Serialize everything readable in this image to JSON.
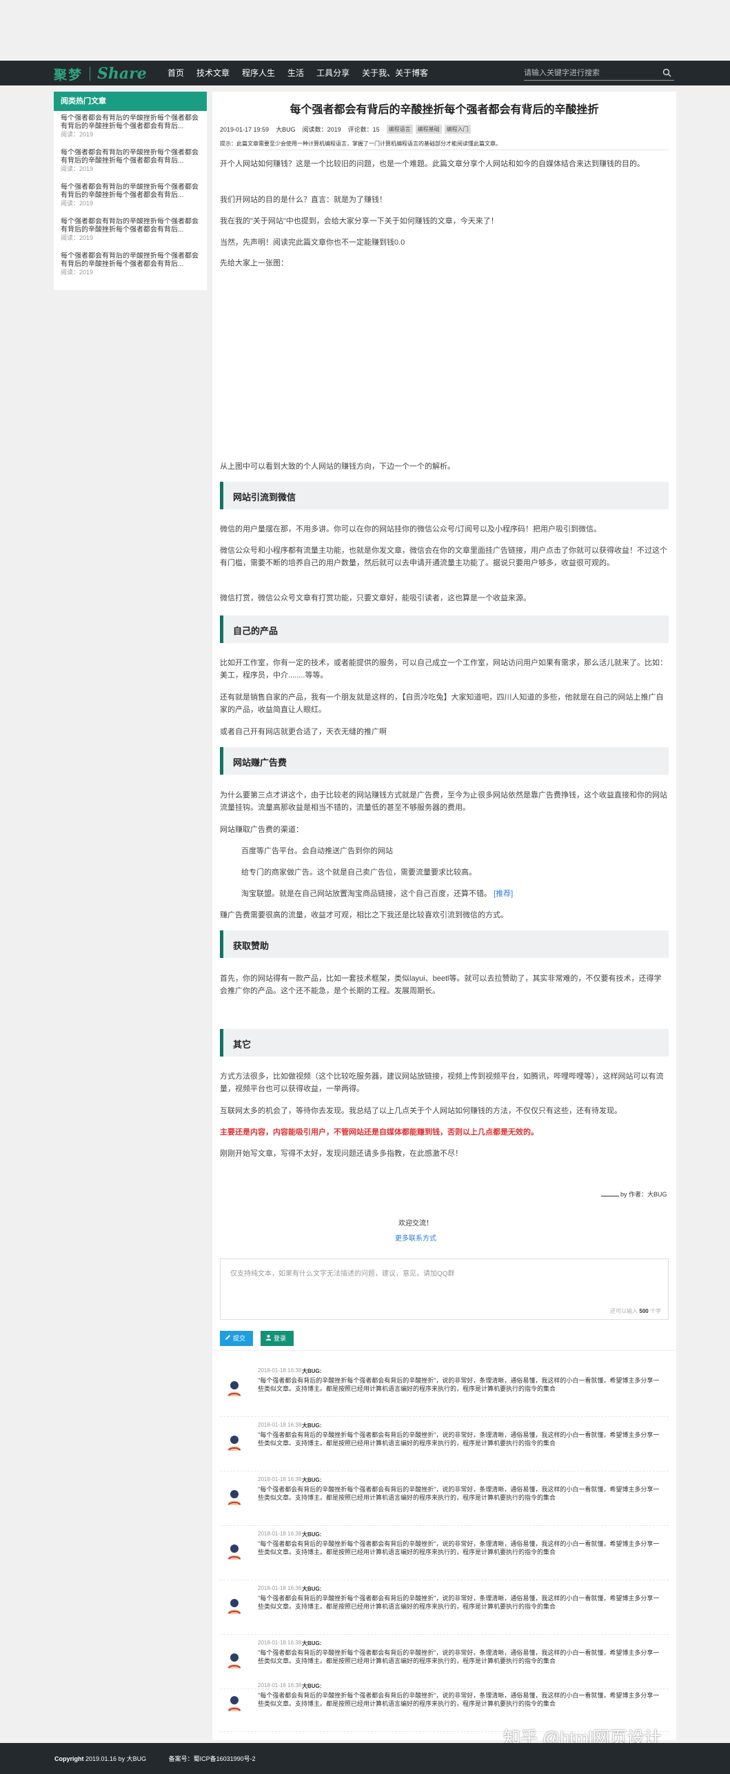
{
  "header": {
    "logo_cn": "聚梦",
    "logo_en": "Share",
    "nav": [
      "首页",
      "技术文章",
      "程序人生",
      "生活",
      "工具分享",
      "关于我、关于博客"
    ],
    "search_placeholder": "请输入关键字进行搜索"
  },
  "sidebar": {
    "title": "阅类热门文章",
    "items": [
      {
        "title": "每个强者都会有背后的辛酸挫折每个强者都会有背后的辛酸挫折每个强者都会有背后...",
        "reads": "阅读：2019"
      },
      {
        "title": "每个强者都会有背后的辛酸挫折每个强者都会有背后的辛酸挫折每个强者都会有背后...",
        "reads": "阅读：2019"
      },
      {
        "title": "每个强者都会有背后的辛酸挫折每个强者都会有背后的辛酸挫折每个强者都会有背后...",
        "reads": "阅读：2019"
      },
      {
        "title": "每个强者都会有背后的辛酸挫折每个强者都会有背后的辛酸挫折每个强者都会有背后...",
        "reads": "阅读：2019"
      },
      {
        "title": "每个强者都会有背后的辛酸挫折每个强者都会有背后的辛酸挫折每个强者都会有背后...",
        "reads": "阅读：2019"
      }
    ]
  },
  "article": {
    "title": "每个强者都会有背后的辛酸挫折每个强者都会有背后的辛酸挫折",
    "date": "2019-01-17 19:59",
    "author": "大BUG",
    "reads": "阅读数：2019",
    "comments": "评论数：15",
    "tags": [
      "编程语言",
      "编程基础",
      "编程入门"
    ],
    "tip": "提示：此篇文章需要至少会使用一种计算机编程语言，掌握了一门计算机编程语言的基础部分才能阅读懂此篇文章。",
    "intro": [
      "开个人网站如何赚钱？这是一个比较旧的问题，也是一个难题。此篇文章分享个人网站和如今的自媒体结合来达到赚钱的目的。",
      "我们开网站的目的是什么？直言：就是为了赚钱！",
      "我在我的\"关于网站\"中也提到，会给大家分享一下关于如何赚钱的文章，今天来了！",
      "当然，先声明！阅读完此篇文章你也不一定能赚到钱0.0",
      "先给大家上一张图："
    ],
    "after_image": "从上图中可以看到大致的个人网站的赚钱方向，下边一个一个的解析。",
    "s1": {
      "heading": "网站引流到微信",
      "p": [
        "微信的用户量摆在那，不用多讲。你可以在你的网站挂你的微信公众号/订阅号以及小程序码！把用户吸引到微信。",
        "微信公众号和小程序都有流量主功能，也就是你发文章，微信会在你的文章里面挂广告链接，用户点击了你就可以获得收益！不过这个有门槛，需要不断的培养自己的用户数量，然后就可以去申请开通流量主功能了。据说只要用户够多，收益很可观的。",
        "微信打赏，微信公众号文章有打赏功能，只要文章好，能吸引读者，这也算是一个收益来源。"
      ]
    },
    "s2": {
      "heading": "自己的产品",
      "p": [
        "比如开工作室，你有一定的技术，或者能提供的服务，可以自己成立一个工作室，网站访问用户如果有需求，那么活儿就来了。比如：美工，程序员，中介........等等。",
        "还有就是销售自家的产品，我有一个朋友就是这样的，【自贡冷吃兔】大家知道吧，四川人知道的多些，他就是在自己的网站上推广自家的产品，收益简直让人眼红。",
        "或者自己开有网店就更合适了，天衣无缝的推广啊"
      ]
    },
    "s3": {
      "heading": "网站赚广告费",
      "p1": "为什么要第三点才讲这个，由于比较老的网站赚钱方式就是广告费，至今为止很多网站依然是靠广告费挣钱，这个收益直接和你的网站流量挂钩。流量高那收益是相当不错的，流量低的甚至不够服务器的费用。",
      "p2": "网站赚取广告费的渠道：",
      "li1": "百度等广告平台。会自动推送广告到你的网站",
      "li2": "给专门的商家做广告。这个就是自己卖广告位，需要流量要求比较高。",
      "li3": "淘宝联盟。就是在自己网站放置淘宝商品链接，这个自己百度，还算不错。",
      "li3_link": "[推荐]",
      "p3": "赚广告费需要很高的流量，收益才可观，相比之下我还是比较喜欢引流到微信的方式。"
    },
    "s4": {
      "heading": "获取赞助",
      "p": "首先，你的网站得有一款产品，比如一套技术框架，类似layui、beetl等。就可以去拉赞助了，其实非常难的，不仅要有技术，还得学会推广你的产品。这个还不能急，是个长期的工程。发展周期长。"
    },
    "s5": {
      "heading": "其它",
      "p1": "方式方法很多，比如做视频（这个比较吃服务器，建议网站放链接，视频上传到视频平台，如腾讯，哔哩哔哩等），这样网站可以有流量，视频平台也可以获得收益，一举两得。",
      "p2": "互联网太多的机会了，等待你去发现。我总结了以上几点关于个人网站如何赚钱的方法，不仅仅只有这些，还有待发现。",
      "red": "主要还是内容，内容能吸引用户，不管网站还是自媒体都能赚到钱，否则以上几点都是无效的。",
      "p3": "刚刚开始写文章，写得不太好，发现问题还请多多指教，在此感激不尽！"
    },
    "author_sign": "by 作者：大BUG",
    "welcome": "欢迎交流！",
    "more_contact": "更多联系方式"
  },
  "comment_form": {
    "placeholder": "仅支持纯文本，如果有什么文字无法描述的问题，建议，意见，请加QQ群",
    "count_prefix": "还可以输入",
    "count": "500",
    "count_suffix": "个字",
    "publish": "提交",
    "login": "登录"
  },
  "comments": [
    {
      "time": "2018-01-18 16:38",
      "user": "大BUG:",
      "text": "\"每个强者都会有背后的辛酸挫折每个强者都会有背后的辛酸挫折\"，说的非常好，条理清晰，通俗易懂，我这样的小白一看就懂，希望博主多分享一些类似文章。支持博主。都是按照已经用计算机语言编好的程序来执行的，程序是计算机要执行的指令的集合"
    },
    {
      "time": "2018-01-18 16:38",
      "user": "大BUG:",
      "text": "\"每个强者都会有背后的辛酸挫折每个强者都会有背后的辛酸挫折\"，说的非常好，条理清晰，通俗易懂，我这样的小白一看就懂，希望博主多分享一些类似文章。支持博主。都是按照已经用计算机语言编好的程序来执行的，程序是计算机要执行的指令的集合"
    },
    {
      "time": "2018-01-18 16:38",
      "user": "大BUG:",
      "text": "\"每个强者都会有背后的辛酸挫折每个强者都会有背后的辛酸挫折\"，说的非常好，条理清晰，通俗易懂，我这样的小白一看就懂，希望博主多分享一些类似文章。支持博主。都是按照已经用计算机语言编好的程序来执行的，程序是计算机要执行的指令的集合"
    },
    {
      "time": "2018-01-18 16:38",
      "user": "大BUG:",
      "text": "\"每个强者都会有背后的辛酸挫折每个强者都会有背后的辛酸挫折\"，说的非常好，条理清晰，通俗易懂，我这样的小白一看就懂，希望博主多分享一些类似文章。支持博主。都是按照已经用计算机语言编好的程序来执行的，程序是计算机要执行的指令的集合"
    },
    {
      "time": "2018-01-18 16:38",
      "user": "大BUG:",
      "text": "\"每个强者都会有背后的辛酸挫折每个强者都会有背后的辛酸挫折\"，说的非常好，条理清晰，通俗易懂，我这样的小白一看就懂，希望博主多分享一些类似文章。支持博主。都是按照已经用计算机语言编好的程序来执行的，程序是计算机要执行的指令的集合"
    },
    {
      "time": "2018-01-18 16:38",
      "user": "大BUG:",
      "text": "\"每个强者都会有背后的辛酸挫折每个强者都会有背后的辛酸挫折\"，说的非常好，条理清晰，通俗易懂，我这样的小白一看就懂，希望博主多分享一些类似文章。支持博主。都是按照已经用计算机语言编好的程序来执行的，程序是计算机要执行的指令的集合"
    },
    {
      "time": "2018-01-18 16:38",
      "user": "大BUG:",
      "text": "\"每个强者都会有背后的辛酸挫折每个强者都会有背后的辛酸挫折\"，说的非常好，条理清晰，通俗易懂，我这样的小白一看就懂，希望博主多分享一些类似文章。支持博主。都是按照已经用计算机语言编好的程序来执行的，程序是计算机要执行的指令的集合"
    }
  ],
  "footer": {
    "copyright": "Copyright",
    "text": "2019.01.16  by  大BUG",
    "icp": "备案号：蜀ICP备16031990号-2"
  },
  "watermark": "知乎 @html网页设计"
}
